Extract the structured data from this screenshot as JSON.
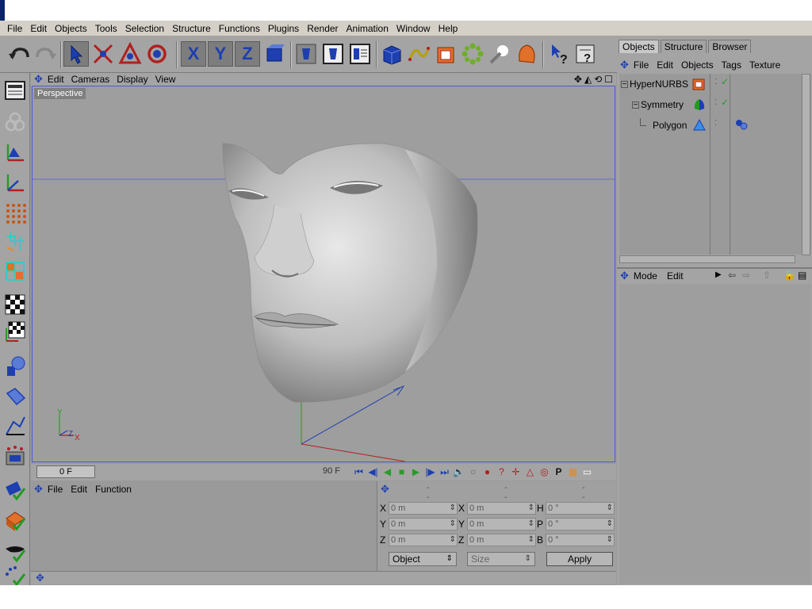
{
  "menubar": [
    "File",
    "Edit",
    "Objects",
    "Tools",
    "Selection",
    "Structure",
    "Functions",
    "Plugins",
    "Render",
    "Animation",
    "Window",
    "Help"
  ],
  "toolbar": {
    "icons": [
      "undo-icon",
      "redo-icon",
      "select-arrow-icon",
      "move-icon",
      "scale-icon",
      "rotate-icon",
      "x-axis-lock-icon",
      "y-axis-lock-icon",
      "z-axis-lock-icon",
      "coordinate-system-icon",
      "render-view-icon",
      "render-picture-viewer-icon",
      "render-settings-icon",
      "cube-primitive-icon",
      "spline-icon",
      "nurbs-icon",
      "array-icon",
      "scene-light-icon",
      "deformer-icon",
      "help-arrow-icon",
      "help-menu-icon"
    ],
    "axis_labels": {
      "x": "X",
      "y": "Y",
      "z": "Z"
    }
  },
  "left_toolbar": {
    "icons": [
      "layout-icon",
      "use-model-tool-icon",
      "object-axis-icon",
      "model-icon",
      "points-mode-icon",
      "edges-mode-icon",
      "polygons-mode-icon",
      "texture-checker-icon",
      "texture-axis-icon",
      "sculpt-icon",
      "pen-icon",
      "knife-icon",
      "select-points-icon",
      "edit-render-icon",
      "enable-snap-icon",
      "render-active-icon",
      "magnet-icon"
    ]
  },
  "viewport": {
    "menu": [
      "Edit",
      "Cameras",
      "Display",
      "View"
    ],
    "label": "Perspective",
    "controls": [
      "move-camera-icon",
      "zoom-camera-icon",
      "rotate-camera-icon",
      "maximize-view-icon"
    ]
  },
  "timeline": {
    "current_frame": "0 F",
    "end_frame": "90 F"
  },
  "coord_panel": {
    "menu": [
      "File",
      "Edit",
      "Function"
    ],
    "headers": [
      "--",
      "--",
      "--"
    ],
    "position": [
      {
        "axis": "X",
        "value": "0 m"
      },
      {
        "axis": "Y",
        "value": "0 m"
      },
      {
        "axis": "Z",
        "value": "0 m"
      }
    ],
    "size": [
      {
        "axis": "X",
        "value": "0 m"
      },
      {
        "axis": "Y",
        "value": "0 m"
      },
      {
        "axis": "Z",
        "value": "0 m"
      }
    ],
    "rotation": [
      {
        "axis": "H",
        "value": "0 °"
      },
      {
        "axis": "P",
        "value": "0 °"
      },
      {
        "axis": "B",
        "value": "0 °"
      }
    ],
    "object_dropdown": "Object",
    "size_dropdown": "Size",
    "apply_label": "Apply"
  },
  "object_manager": {
    "tabs": [
      "Objects",
      "Structure",
      "Browser"
    ],
    "menu": [
      "File",
      "Edit",
      "Objects",
      "Tags",
      "Texture"
    ],
    "objects": [
      {
        "name": "HyperNURBS",
        "icon": "hypernurbs-icon"
      },
      {
        "name": "Symmetry",
        "icon": "symmetry-icon"
      },
      {
        "name": "Polygon",
        "icon": "polygon-icon"
      }
    ]
  },
  "attribute_manager": {
    "menu": [
      "Mode",
      "Edit"
    ]
  },
  "colors": {
    "panel": "#a4a4a4",
    "viewport_border": "#4b5bd6",
    "icon_blue": "#1d3fb0",
    "check_green": "#1f9b1f"
  }
}
